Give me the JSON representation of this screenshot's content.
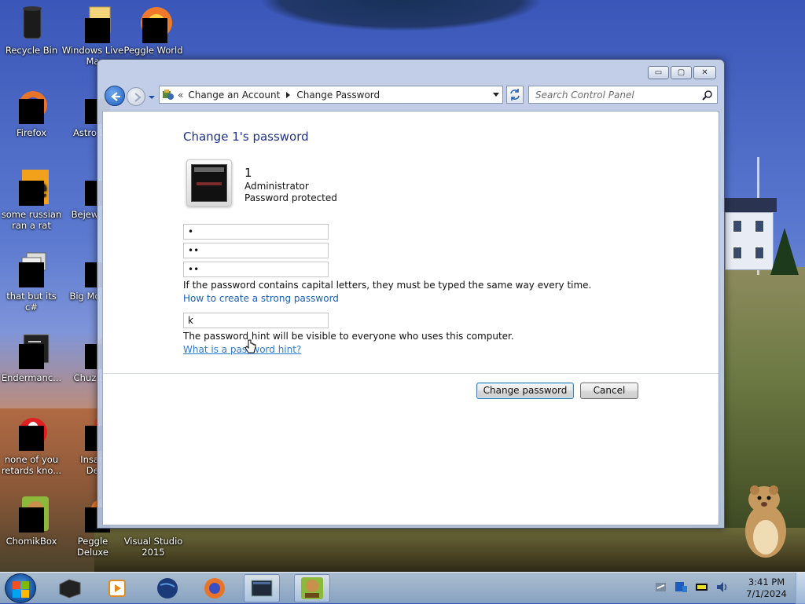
{
  "desktop": {
    "icons": [
      {
        "label": "Recycle Bin"
      },
      {
        "label": "Windows Live Ma"
      },
      {
        "label": "Peggle World"
      },
      {
        "label": "Firefox"
      },
      {
        "label": "Astro Delu"
      },
      {
        "label": "some russian ran a rat"
      },
      {
        "label": "Bejew Delu"
      },
      {
        "label": "that but its c#"
      },
      {
        "label": "Big Mo Delu"
      },
      {
        "label": "Endermanc..."
      },
      {
        "label": "Chuz Delu"
      },
      {
        "label": "none of you retards kno..."
      },
      {
        "label": "Insaniq Delu"
      },
      {
        "label": "ChomikBox"
      },
      {
        "label": "Peggle Deluxe"
      },
      {
        "label": "Visual Studio 2015"
      }
    ]
  },
  "window": {
    "controls": {
      "minimize": "▭",
      "maximize": "▢",
      "close": "✕"
    },
    "address": {
      "overflow": "«",
      "crumbs": [
        "Change an Account",
        "Change Password"
      ]
    },
    "search": {
      "placeholder": "Search Control Panel"
    },
    "content": {
      "title": "Change 1's password",
      "account": {
        "name": "1",
        "role": "Administrator",
        "status": "Password protected"
      },
      "fields": {
        "current_password": "•",
        "new_password": "••",
        "confirm_password": "••",
        "hint": "k"
      },
      "caps_note": "If the password contains capital letters, they must be typed the same way every time.",
      "strong_link": "How to create a strong password",
      "hint_note": "The password hint will be visible to everyone who uses this computer.",
      "hint_link": "What is a password hint?",
      "buttons": {
        "change": "Change password",
        "cancel": "Cancel"
      }
    }
  },
  "taskbar": {
    "clock": {
      "time": "3:41 PM",
      "date": "7/1/2024"
    }
  },
  "colors": {
    "title_blue": "#1e3287",
    "link_blue": "#1a60b5",
    "taskbar": "#a8c0e0"
  }
}
